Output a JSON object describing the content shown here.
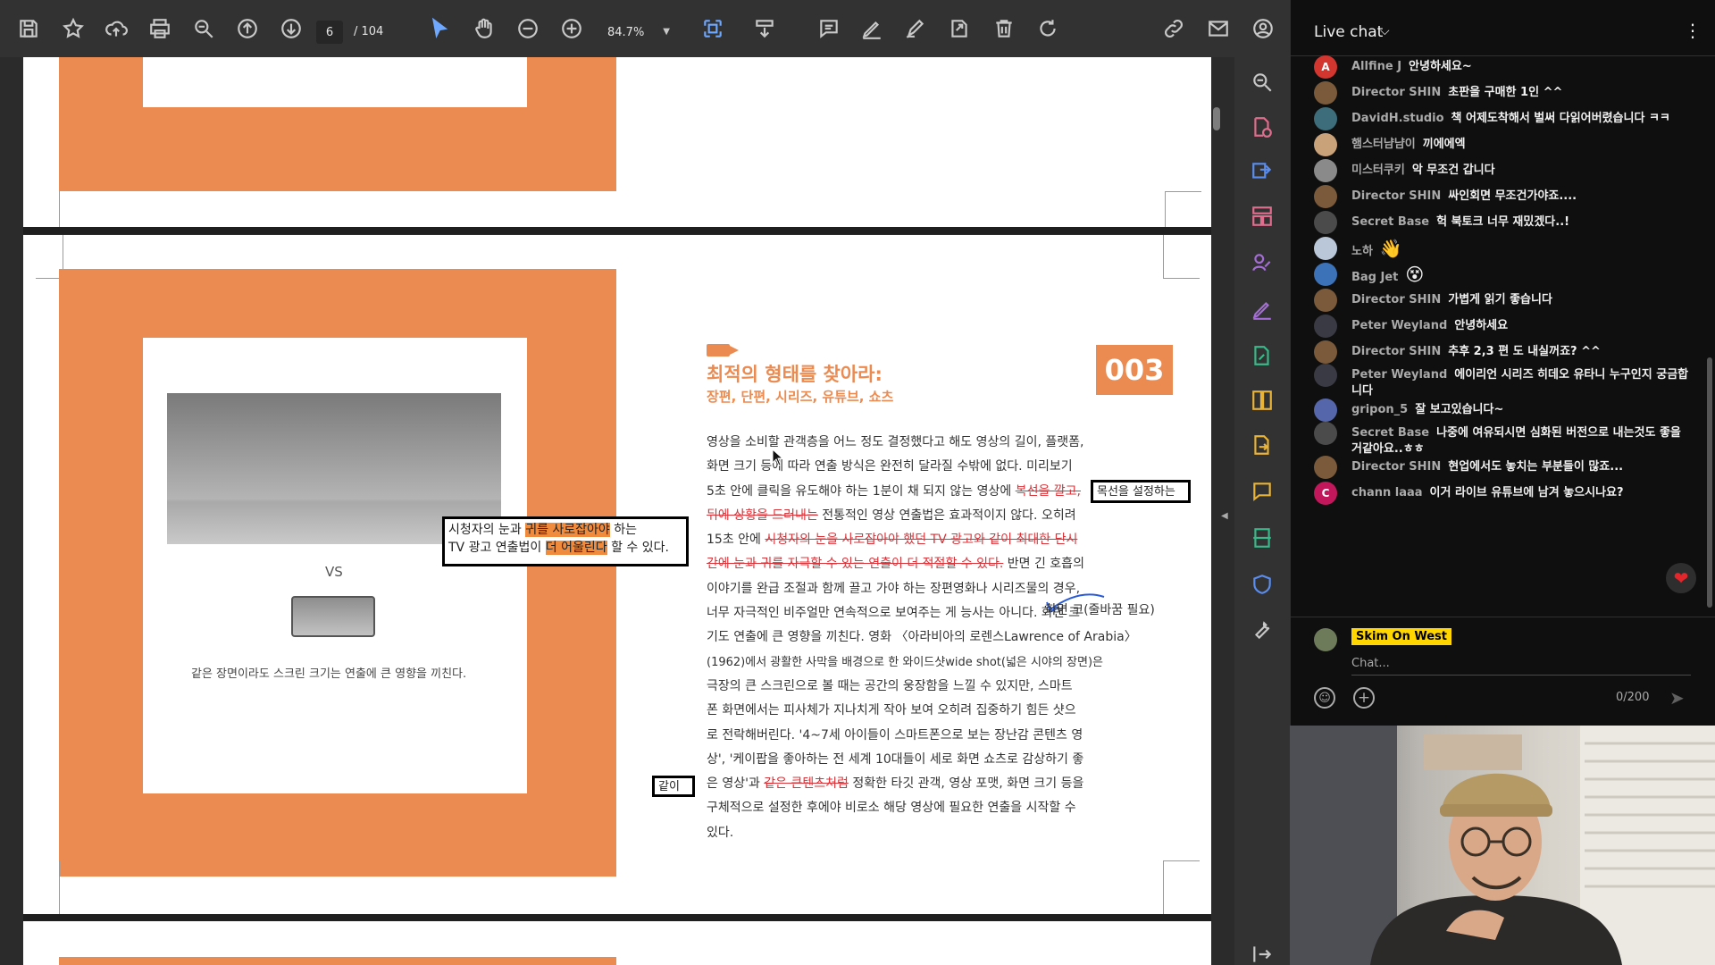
{
  "toolbar": {
    "page_current": "6",
    "page_total": "/ 104",
    "zoom": "84.7%"
  },
  "document": {
    "left_caption": "같은 장면이라도 스크린 크기는 연출에 큰 영향을 끼친다.",
    "vs_label": "VS",
    "annotation_box1_line1_pre": "시청자의 눈과 ",
    "annotation_box1_line1_hl": "귀를 사로잡아야",
    "annotation_box1_line1_post": " 하는",
    "annotation_box1_line2_pre": "TV 광고 연출법이 ",
    "annotation_box1_line2_hl": "더 어울린다",
    "annotation_box1_line2_post": " 할 수 있다.",
    "annotation_box2": "목선을 설정하는",
    "annotation_box3": "같이",
    "chapter_title": "최적의 형태를 찾아라:",
    "chapter_subtitle": "장편, 단편, 시리즈, 유튜브, 쇼츠",
    "chapter_number": "003",
    "side_note": "화면 크(줄바꿈 필요)",
    "body": {
      "l1": "영상을 소비할 관객층을 어느 정도 결정했다고 해도 영상의 길이, 플랫폼,",
      "l2": "화면 크기 등에 따라 연출 방식은 완전히 달라질 수밖에 없다. 미리보기",
      "l3_pre": "5초 안에 클릭을 유도해야 하는 1분이 채 되지 않는 영상에 ",
      "l3_strike": "복선을 깔고,",
      "l4_strike": "뒤에 상황을 드러내는",
      "l4_post": " 전통적인 영상 연출법은 효과적이지 않다. 오히려",
      "l5_pre": "15초 안에 ",
      "l5_strike": "시청자의 눈을 사로잡아야 했던 TV 광고와 같이 최대한 단시",
      "l6_strike": "간에 눈과 귀를 자극할 수 있는 연출이 더 적절할 수 있다.",
      "l6_post": " 반면 긴 호흡의",
      "l7": "이야기를 완급 조절과 함께 끌고 가야 하는 장편영화나 시리즈물의 경우,",
      "l8": "너무 자극적인 비주얼만 연속적으로 보여주는 게 능사는 아니다. 화면 크",
      "l9": "기도 연출에 큰 영향을 끼친다. 영화 〈아라비아의 로렌스Lawrence of Arabia〉",
      "l10": "(1962)에서 광활한 사막을 배경으로 한 와이드샷wide shot(넓은 시야의 장면)은",
      "l11": "극장의 큰 스크린으로 볼 때는 공간의 웅장함을 느낄 수 있지만, 스마트",
      "l12": "폰 화면에서는 피사체가 지나치게 작아 보여 오히려 집중하기 힘든 샷으",
      "l13": "로 전락해버린다. '4~7세 아이들이 스마트폰으로 보는 장난감 콘텐츠 영",
      "l14": "상', '케이팝을 좋아하는 전 세계 10대들이 세로 화면 쇼츠로 감상하기 좋",
      "l15_pre": "은 영상'과 ",
      "l15_strike": "같은 큰텐츠처럼",
      "l15_post": " 정확한 타깃 관객, 영상 포맷, 화면 크기 등을",
      "l16": "구체적으로 설정한 후에야 비로소 해당 영상에 필요한 연출을 시작할 수",
      "l17": "있다."
    }
  },
  "chat": {
    "title": "Live chat",
    "messages": [
      {
        "author": "Allfine J",
        "text": "안녕하세요~",
        "avatar_letter": "A",
        "color": "#d3352f"
      },
      {
        "author": "Director SHIN",
        "text": "초판을 구매한 1인 ^^",
        "avatar_letter": "",
        "color": "#7a5a3a"
      },
      {
        "author": "DavidH.studio",
        "text": "책 어제도착해서 벌써 다읽어버렸습니다 ㅋㅋ",
        "avatar_letter": "",
        "color": "#3d6d7a"
      },
      {
        "author": "햄스터냠냠이",
        "text": "끼에에엑",
        "avatar_letter": "",
        "color": "#c9a27a"
      },
      {
        "author": "미스터쿠키",
        "text": "악 무조건 갑니다",
        "avatar_letter": "",
        "color": "#8a8a8a"
      },
      {
        "author": "Director SHIN",
        "text": "싸인회면 무조건가야죠....",
        "avatar_letter": "",
        "color": "#7a5a3a"
      },
      {
        "author": "Secret Base",
        "text": "헉 북토크 너무 재밌겠다..!",
        "avatar_letter": "",
        "color": "#4b4b4b"
      },
      {
        "author": "노하",
        "text": "",
        "emoji": "👋",
        "avatar_letter": "",
        "color": "#b9c7d8"
      },
      {
        "author": "Bag Jet",
        "text": "",
        "emoji": "😵",
        "avatar_letter": "",
        "color": "#3c72b8"
      },
      {
        "author": "Director SHIN",
        "text": "가볍게 읽기 좋습니다",
        "avatar_letter": "",
        "color": "#7a5a3a"
      },
      {
        "author": "Peter Weyland",
        "text": "안녕하세요",
        "avatar_letter": "",
        "color": "#3a3a44"
      },
      {
        "author": "Director SHIN",
        "text": "추후 2,3 편 도 내실꺼죠? ^^",
        "avatar_letter": "",
        "color": "#7a5a3a"
      },
      {
        "author": "Peter Weyland",
        "text": "에이리언 시리즈 히데오 유타니 누구인지 궁금합니다",
        "avatar_letter": "",
        "color": "#3a3a44"
      },
      {
        "author": "gripon_5",
        "text": "잘 보고있습니다~",
        "avatar_letter": "",
        "color": "#5566aa"
      },
      {
        "author": "Secret Base",
        "text": "나중에 여유되시면 심화된 버전으로 내는것도 좋을거같아요..ㅎㅎ",
        "avatar_letter": "",
        "color": "#4b4b4b"
      },
      {
        "author": "Director SHIN",
        "text": "현업에서도 놓치는 부분들이 많죠...",
        "avatar_letter": "",
        "color": "#7a5a3a"
      },
      {
        "author": "chann laaa",
        "text": "이거 라이브 유튜브에 남겨 놓으시나요?",
        "avatar_letter": "C",
        "color": "#c2185b"
      }
    ],
    "composer_name": "Skim On West",
    "placeholder": "Chat...",
    "char_count": "0/200"
  }
}
